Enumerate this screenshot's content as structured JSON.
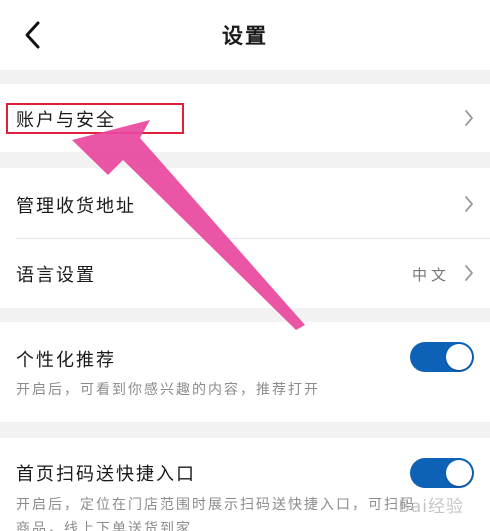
{
  "header": {
    "title": "设置",
    "back_icon": "chevron-left-icon"
  },
  "sections": {
    "account": {
      "label": "账户与安全"
    },
    "address": {
      "label": "管理收货地址"
    },
    "language": {
      "label": "语言设置",
      "value": "中文"
    },
    "recommend": {
      "label": "个性化推荐",
      "description": "开启后，可看到你感兴趣的内容，推荐打开",
      "enabled": true
    },
    "scan": {
      "label": "首页扫码送快捷入口",
      "description_line1": "开启后，定位在门店范围时展示扫码送快捷入口，可扫码",
      "description_line2": "商品，线上下单送货到家",
      "enabled": true
    }
  },
  "annotations": {
    "highlight_color": "#e0203a",
    "arrow_color": "#e8479d",
    "watermark": "Bai经验"
  },
  "colors": {
    "toggle_on": "#0d62b8",
    "background": "#f2f2f2",
    "card": "#ffffff"
  }
}
